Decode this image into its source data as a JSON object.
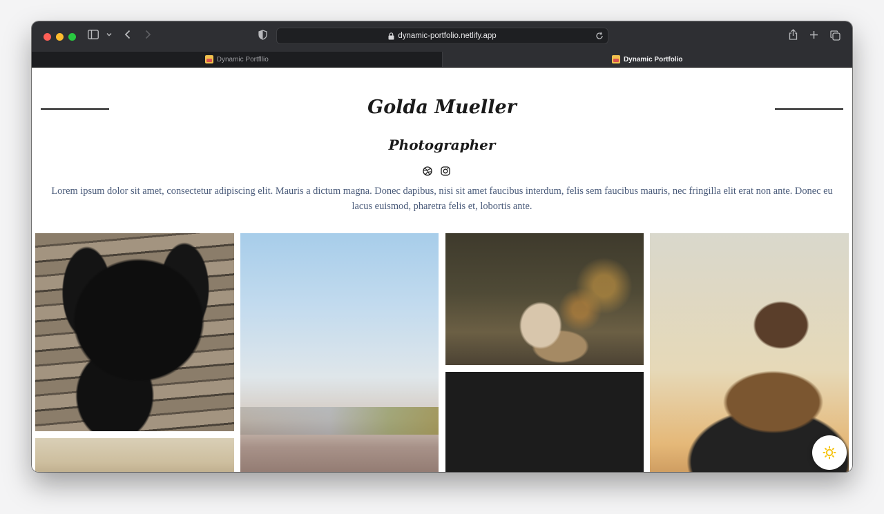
{
  "browser": {
    "url": "dynamic-portfolio.netlify.app",
    "tabs": [
      {
        "label": "Dynamic Portfllio",
        "active": false
      },
      {
        "label": "Dynamic Portfolio",
        "active": true
      }
    ]
  },
  "hero": {
    "name": "Golda Mueller",
    "role": "Photographer",
    "bio": "Lorem ipsum dolor sit amet, consectetur adipiscing elit. Mauris a dictum magna. Donec dapibus, nisi sit amet faucibus interdum, felis sem faucibus mauris, nec fringilla elit erat non ante. Donec eu lacus euismod, pharetra felis et, lobortis ante.",
    "socials": [
      "dribbble-icon",
      "instagram-icon"
    ]
  },
  "gallery": [
    "puppy",
    "beach",
    "deer",
    "dark",
    "woman-scarf",
    "sky"
  ],
  "colors": {
    "accent_sun": "#f5c518",
    "bio_text": "#4a5b7a",
    "chrome": "#2e2f33"
  }
}
